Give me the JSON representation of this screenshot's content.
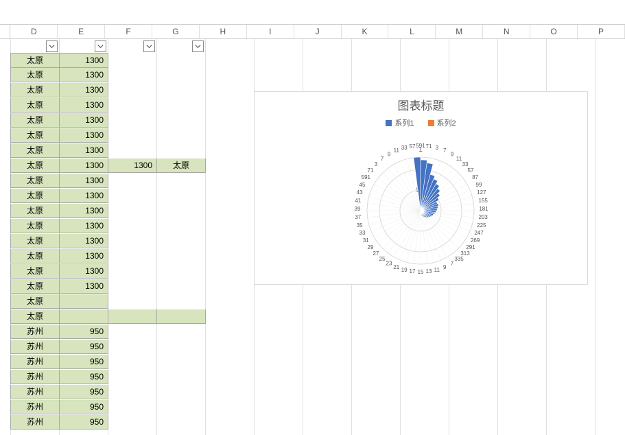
{
  "column_headers": [
    "D",
    "E",
    "F",
    "G",
    "H",
    "I",
    "J",
    "K",
    "L",
    "M",
    "N",
    "O",
    "P"
  ],
  "filter_columns": [
    "D",
    "E",
    "F",
    "G"
  ],
  "rows": [
    {
      "d": "太原",
      "e": "1300"
    },
    {
      "d": "太原",
      "e": "1300"
    },
    {
      "d": "太原",
      "e": "1300"
    },
    {
      "d": "太原",
      "e": "1300"
    },
    {
      "d": "太原",
      "e": "1300"
    },
    {
      "d": "太原",
      "e": "1300"
    },
    {
      "d": "太原",
      "e": "1300"
    },
    {
      "d": "太原",
      "e": "1300",
      "f": "1300",
      "g": "太原"
    },
    {
      "d": "太原",
      "e": "1300"
    },
    {
      "d": "太原",
      "e": "1300"
    },
    {
      "d": "太原",
      "e": "1300"
    },
    {
      "d": "太原",
      "e": "1300"
    },
    {
      "d": "太原",
      "e": "1300"
    },
    {
      "d": "太原",
      "e": "1300"
    },
    {
      "d": "太原",
      "e": "1300"
    },
    {
      "d": "太原",
      "e": "1300"
    },
    {
      "d": "太原",
      "e": ""
    },
    {
      "d": "太原",
      "e": ""
    },
    {
      "d": "苏州",
      "e": "950"
    },
    {
      "d": "苏州",
      "e": "950"
    },
    {
      "d": "苏州",
      "e": "950"
    },
    {
      "d": "苏州",
      "e": "950"
    },
    {
      "d": "苏州",
      "e": "950"
    },
    {
      "d": "苏州",
      "e": "950"
    },
    {
      "d": "苏州",
      "e": "950"
    }
  ],
  "extra_fg_row_at": 17,
  "chart": {
    "title": "图表标题",
    "legend": [
      {
        "name": "系列1",
        "color": "#4472C4"
      },
      {
        "name": "系列2",
        "color": "#ED7D31"
      }
    ],
    "radial_ticks": [
      {
        "label": "500",
        "value": 500
      },
      {
        "label": "1000",
        "value": 1000
      }
    ],
    "max_value": 1300,
    "top_axis_label": "1",
    "ring_labels_sample": [
      "591",
      "71",
      "181"
    ],
    "chart_data": {
      "type": "radar",
      "description": "Polar/radar chart with many category spokes (numeric labels crowded around the perimeter). Series1 (blue) shows tall filled wedges clustered near the top peaking around 1300 and tapering to near 0 on lower spokes. Series2 (orange) not visibly drawn.",
      "radial_axis": {
        "min": 0,
        "max": 1300,
        "ticks": [
          0,
          500,
          1000
        ]
      },
      "series": [
        {
          "name": "系列1",
          "approx_peak": 1300,
          "approx_min": 0,
          "shape": "bars clustered around azimuth ~0° to ~120° with decreasing height"
        },
        {
          "name": "系列2",
          "approx_peak": null,
          "note": "legend entry present, data not visibly rendered"
        }
      ]
    }
  }
}
